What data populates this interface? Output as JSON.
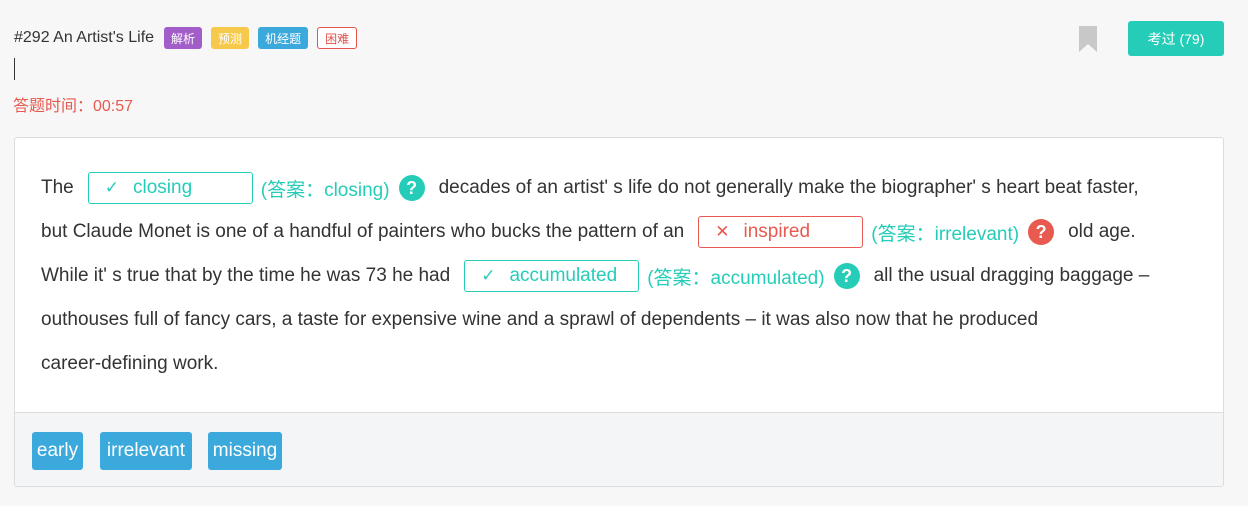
{
  "header": {
    "title": "#292 An Artist's Life",
    "tags": [
      "解析",
      "预测",
      "机经题",
      "困难"
    ]
  },
  "timer": "答题时间：00:57",
  "passed_button": "考过 (79)",
  "passage": {
    "l1_a": "The",
    "blank1": {
      "mark": "✓",
      "value": "closing",
      "answer": "(答案：closing)",
      "status": "correct"
    },
    "l1_b": "decades of an artist' s life do not generally make the biographer' s heart beat faster,",
    "l2_a": "but Claude Monet is one of a handful of painters who bucks the pattern of an",
    "blank2": {
      "mark": "✕",
      "value": "inspired",
      "answer": "(答案：irrelevant)",
      "status": "wrong"
    },
    "l2_b": "old age.",
    "l3_a": "While it' s true that by the time he was 73 he had",
    "blank3": {
      "mark": "✓",
      "value": "accumulated",
      "answer": "(答案：accumulated)",
      "status": "correct"
    },
    "l3_b": "all the usual dragging baggage –",
    "l4": "outhouses full of fancy cars, a taste for expensive wine and a sprawl of dependents – it was also now that he produced",
    "l5": "career-defining work.",
    "help_symbol": "?"
  },
  "options": [
    "early",
    "irrelevant",
    "missing"
  ],
  "colors": {
    "accent": "#25cdb8",
    "error": "#e85a4f",
    "chip": "#3ba9dc"
  }
}
